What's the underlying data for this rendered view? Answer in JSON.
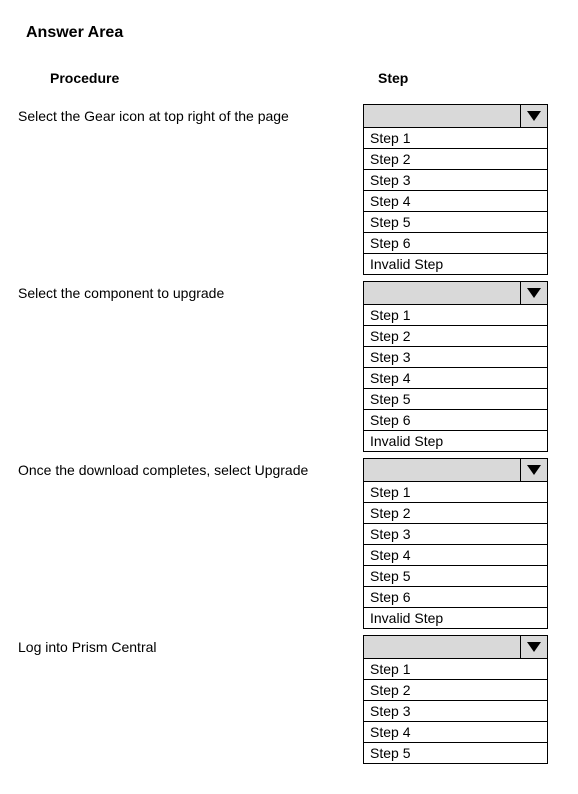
{
  "title": "Answer Area",
  "headers": {
    "procedure": "Procedure",
    "step": "Step"
  },
  "rows": [
    {
      "procedure": "Select the Gear icon at top right of the page",
      "options": [
        "Step 1",
        "Step 2",
        "Step 3",
        "Step 4",
        "Step 5",
        "Step 6",
        "Invalid Step"
      ]
    },
    {
      "procedure": "Select the component to upgrade",
      "options": [
        "Step 1",
        "Step 2",
        "Step 3",
        "Step 4",
        "Step 5",
        "Step 6",
        "Invalid Step"
      ]
    },
    {
      "procedure": "Once the download completes, select Upgrade",
      "options": [
        "Step 1",
        "Step 2",
        "Step 3",
        "Step 4",
        "Step 5",
        "Step 6",
        "Invalid Step"
      ]
    },
    {
      "procedure": "Log into Prism Central",
      "options": [
        "Step 1",
        "Step 2",
        "Step 3",
        "Step 4",
        "Step 5"
      ]
    }
  ]
}
